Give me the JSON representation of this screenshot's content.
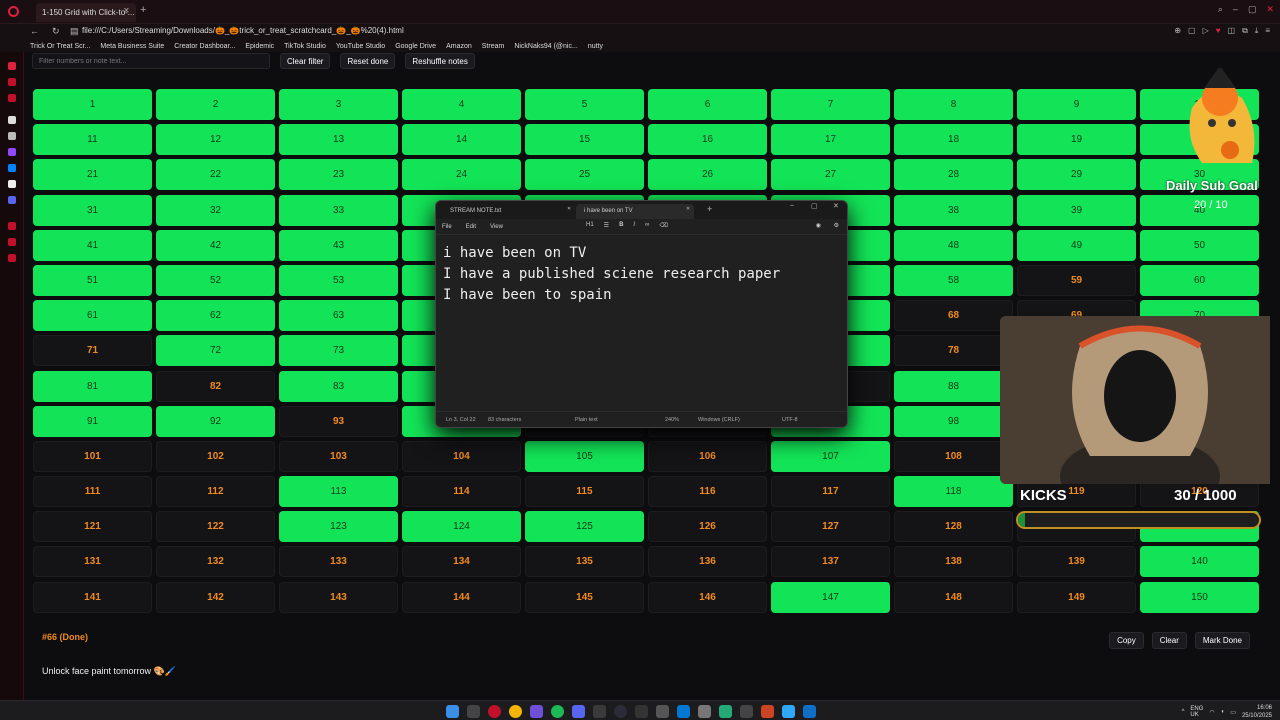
{
  "browser": {
    "tab_title": "1-150 Grid with Click-to-...",
    "url": "file:///C:/Users/Streaming/Downloads/🎃_🎃trick_or_treat_scratchcard_🎃_🎃%20(4).html",
    "bookmarks": [
      "Trick Or Treat Scr...",
      "Meta Business Suite",
      "Creator Dashboar...",
      "Epidemic",
      "TikTok Studio",
      "YouTube Studio",
      "Google Drive",
      "Amazon",
      "Stream",
      "NickNaks94 (@nic...",
      "nutty"
    ]
  },
  "toolbar": {
    "filter_placeholder": "Filter numbers or note text...",
    "clear_filter": "Clear filter",
    "reset_done": "Reset done",
    "reshuffle_notes": "Reshuffle notes"
  },
  "grid": {
    "count": 150,
    "done_numbers": [
      1,
      2,
      3,
      4,
      5,
      6,
      7,
      8,
      9,
      10,
      11,
      12,
      13,
      14,
      15,
      16,
      17,
      18,
      19,
      20,
      21,
      22,
      23,
      24,
      25,
      26,
      27,
      28,
      29,
      30,
      31,
      32,
      33,
      34,
      35,
      36,
      37,
      38,
      39,
      40,
      41,
      42,
      43,
      44,
      45,
      46,
      47,
      48,
      49,
      50,
      51,
      52,
      53,
      54,
      55,
      56,
      57,
      58,
      60,
      61,
      62,
      63,
      64,
      67,
      70,
      72,
      73,
      74,
      77,
      81,
      83,
      84,
      88,
      91,
      92,
      94,
      97,
      98,
      105,
      107,
      113,
      118,
      123,
      124,
      125,
      130,
      140,
      147,
      150
    ],
    "colors": {
      "done": "#13e457",
      "pending_text": "#f28b1e"
    }
  },
  "note": {
    "title": "#66 (Done)",
    "text": "Unlock face paint tomorrow 🎨🖌️",
    "copy": "Copy",
    "clear": "Clear",
    "mark_done": "Mark Done"
  },
  "notepad": {
    "tab1": "STREAM NOTE.txt",
    "tab2": "i have been on TV",
    "menu": [
      "File",
      "Edit",
      "View"
    ],
    "heading": "H1",
    "content": "i have been on TV\nI have a published sciene research paper\nI have been to spain",
    "status_position": "Ln 3, Col 22",
    "status_chars": "83 characters",
    "status_type": "Plain text",
    "status_zoom": "240%",
    "status_eol": "Windows (CRLF)",
    "status_encoding": "UTF-8"
  },
  "overlay": {
    "sub_goal_label": "Daily Sub Goal",
    "sub_goal_value": "20 / 10",
    "kicks_label": "KICKS",
    "kicks_value": "30 / 1000",
    "kicks_progress": 0.03
  },
  "tray": {
    "lang": "ENG\nUK",
    "time": "16:06",
    "date": "25/10/2025"
  }
}
